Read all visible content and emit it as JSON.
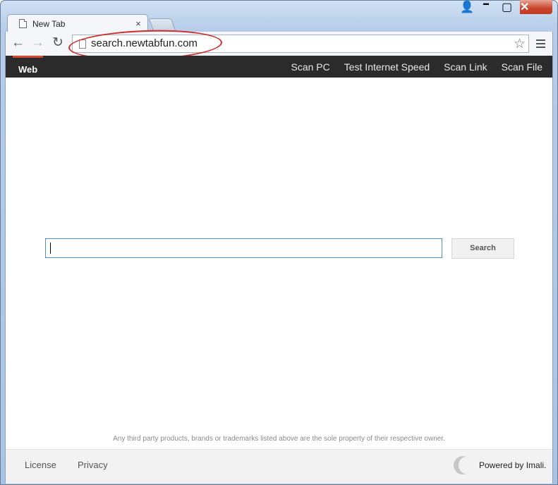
{
  "browser": {
    "tab_title": "New Tab",
    "tab_close": "×",
    "url": "search.newtabfun.com",
    "controls": {
      "user": "👤",
      "minimize": "▬",
      "maximize": "▢",
      "close": "✕"
    },
    "nav": {
      "back": "←",
      "forward": "→",
      "reload": "↻",
      "star": "☆"
    }
  },
  "topnav": {
    "active": "Web",
    "links": [
      "Scan PC",
      "Test Internet Speed",
      "Scan Link",
      "Scan File"
    ]
  },
  "search": {
    "input_value": "",
    "button_label": "Search"
  },
  "disclaimer": "Any third party products, brands or trademarks listed above are the sole property of their respective owner.",
  "footer": {
    "license": "License",
    "privacy": "Privacy",
    "powered_by": "Powered by Imali."
  },
  "colors": {
    "annotation": "#d42a2a",
    "nav_bg": "#2b2b2b",
    "active_accent": "#d9442c"
  }
}
